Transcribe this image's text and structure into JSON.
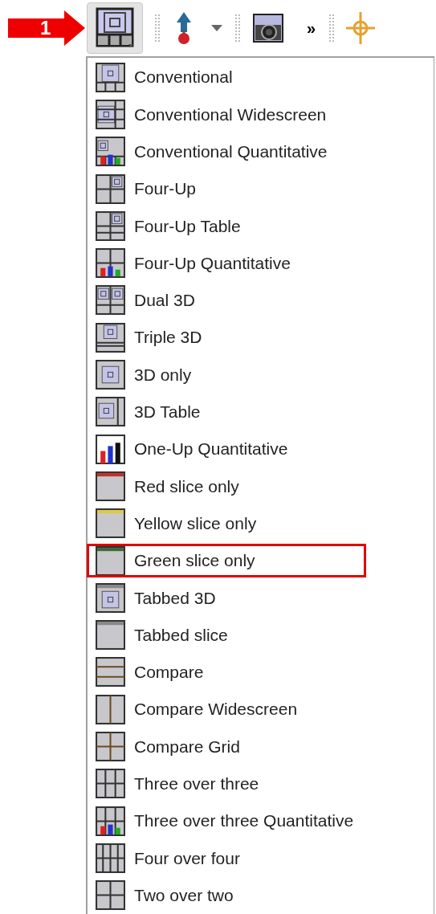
{
  "callout": {
    "label": "1"
  },
  "toolbar": [
    {
      "kind": "layout",
      "pressed": true
    },
    {
      "kind": "separator"
    },
    {
      "kind": "pin",
      "pressed": false
    },
    {
      "kind": "caret",
      "pressed": false
    },
    {
      "kind": "separator"
    },
    {
      "kind": "camera",
      "pressed": false
    },
    {
      "kind": "more",
      "label": "»",
      "pressed": false
    },
    {
      "kind": "separator"
    },
    {
      "kind": "crosshair",
      "pressed": false
    }
  ],
  "menu": {
    "items": [
      {
        "label": "Conventional",
        "kind": "conventional",
        "annotated": false
      },
      {
        "label": "Conventional Widescreen",
        "kind": "widescreen",
        "annotated": false
      },
      {
        "label": "Conventional Quantitative",
        "kind": "quantitative",
        "annotated": false
      },
      {
        "label": "Four-Up",
        "kind": "fourup",
        "annotated": false
      },
      {
        "label": "Four-Up Table",
        "kind": "fourtable",
        "annotated": false
      },
      {
        "label": "Four-Up Quantitative",
        "kind": "fourquant",
        "annotated": false
      },
      {
        "label": "Dual 3D",
        "kind": "dual",
        "annotated": false
      },
      {
        "label": "Triple 3D",
        "kind": "triple",
        "annotated": false
      },
      {
        "label": "3D only",
        "kind": "single3d",
        "annotated": false
      },
      {
        "label": "3D Table",
        "kind": "table3d",
        "annotated": false
      },
      {
        "label": "One-Up Quantitative",
        "kind": "chart",
        "annotated": false
      },
      {
        "label": "Red slice only",
        "kind": "red",
        "annotated": false
      },
      {
        "label": "Yellow slice only",
        "kind": "yellow",
        "annotated": false
      },
      {
        "label": "Green slice only",
        "kind": "green",
        "annotated": true
      },
      {
        "label": "Tabbed 3D",
        "kind": "tabbed3d",
        "annotated": false
      },
      {
        "label": "Tabbed slice",
        "kind": "tabbedslice",
        "annotated": false
      },
      {
        "label": "Compare",
        "kind": "compare",
        "annotated": false
      },
      {
        "label": "Compare Widescreen",
        "kind": "comparewide",
        "annotated": false
      },
      {
        "label": "Compare Grid",
        "kind": "comparegrid",
        "annotated": false
      },
      {
        "label": "Three over three",
        "kind": "threebythree",
        "annotated": false
      },
      {
        "label": "Three over three Quantitative",
        "kind": "threequant",
        "annotated": false
      },
      {
        "label": "Four over four",
        "kind": "fourbyfour",
        "annotated": false
      },
      {
        "label": "Two over two",
        "kind": "twobytwo",
        "annotated": false
      }
    ]
  }
}
